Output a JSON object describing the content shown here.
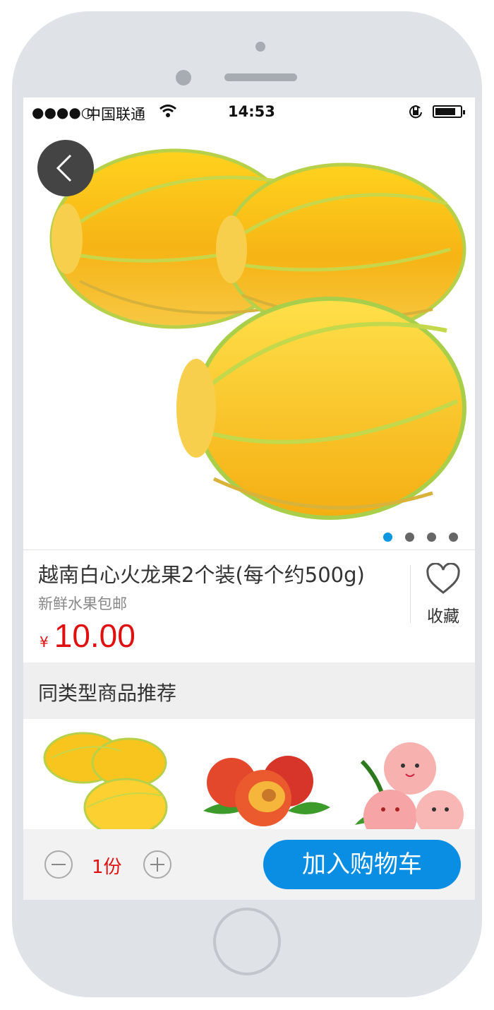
{
  "status_bar": {
    "signal": "●●●●○",
    "carrier": "中国联通",
    "time": "14:53"
  },
  "icons": {
    "back": "chevron-left-icon",
    "favorite": "heart-icon",
    "minus": "minus-icon",
    "plus": "plus-icon"
  },
  "colors": {
    "accent": "#0a8ee3",
    "price": "#e01010",
    "active_dot": "#0a96e0"
  },
  "carousel": {
    "slide_count": 4,
    "active_index": 0
  },
  "product": {
    "title": "越南白心火龙果2个装(每个约500g)",
    "subtitle": "新鲜水果包邮",
    "currency": "¥",
    "price": "10.00",
    "favorite_label": "收藏"
  },
  "recommend": {
    "title": "同类型商品推荐"
  },
  "bottom": {
    "quantity": "1份",
    "add_to_cart": "加入购物车"
  }
}
